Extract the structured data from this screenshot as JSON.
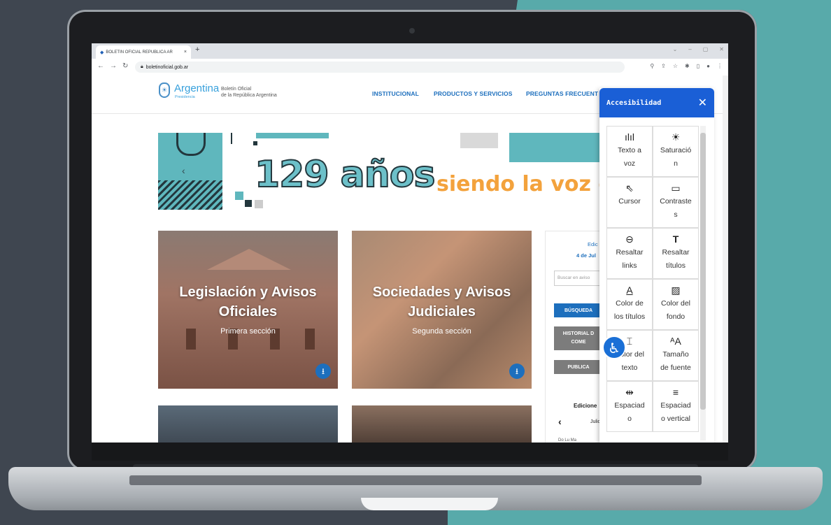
{
  "browser": {
    "tab_title": "BOLETIN OFICIAL REPUBLICA AR",
    "tab_close": "×",
    "new_tab": "+",
    "url": "boletinoficial.gob.ar",
    "window_controls": [
      "⌄",
      "–",
      "▢",
      "✕"
    ]
  },
  "site": {
    "logo_text": "Argentina",
    "logo_sub": "Presidencia",
    "org_line1": "Boletín Oficial",
    "org_line2": "de la República Argentina",
    "menu": [
      "INSTITUCIONAL",
      "PRODUCTOS Y SERVICIOS",
      "PREGUNTAS FRECUENT"
    ]
  },
  "banner": {
    "number": "129 años",
    "tagline": "siendo la voz of"
  },
  "cards": [
    {
      "title_1": "Legislación y Avisos",
      "title_2": "Oficiales",
      "subtitle": "Primera sección"
    },
    {
      "title_1": "Sociedades y Avisos",
      "title_2": "Judiciales",
      "subtitle": "Segunda sección"
    }
  ],
  "sidebar": {
    "edition": "Edic",
    "date": "4 de Jul",
    "search_placeholder": "Buscar en aviso",
    "search_button": "BÚSQUEDA",
    "history_line1": "HISTORIAL D",
    "history_line2": "COME",
    "publish_button": "PUBLICA",
    "editions_label": "Edicione",
    "month": "Julio",
    "weekdays": "Do  Lu  Ma"
  },
  "accessibility": {
    "title": "Accesibilidad",
    "items": [
      {
        "label_1": "Texto a",
        "label_2": "voz",
        "icon": "audio-wave-icon"
      },
      {
        "label_1": "Saturació",
        "label_2": "n",
        "icon": "sun-icon"
      },
      {
        "label_1": "Cursor",
        "label_2": "",
        "icon": "cursor-icon"
      },
      {
        "label_1": "Contraste",
        "label_2": "s",
        "icon": "monitor-icon"
      },
      {
        "label_1": "Resaltar",
        "label_2": "links",
        "icon": "link-icon"
      },
      {
        "label_1": "Resaltar",
        "label_2": "títulos",
        "icon": "title-icon"
      },
      {
        "label_1": "Color de",
        "label_2": "los títulos",
        "icon": "text-color-icon"
      },
      {
        "label_1": "Color del",
        "label_2": "fondo",
        "icon": "image-icon"
      },
      {
        "label_1": "Color del",
        "label_2": "texto",
        "icon": "text-box-icon"
      },
      {
        "label_1": "Tamaño",
        "label_2": "de fuente",
        "icon": "font-size-icon"
      },
      {
        "label_1": "Espaciad",
        "label_2": "o",
        "icon": "horizontal-spacing-icon"
      },
      {
        "label_1": "Espaciad",
        "label_2": "o vertical",
        "icon": "vertical-spacing-icon"
      }
    ]
  }
}
